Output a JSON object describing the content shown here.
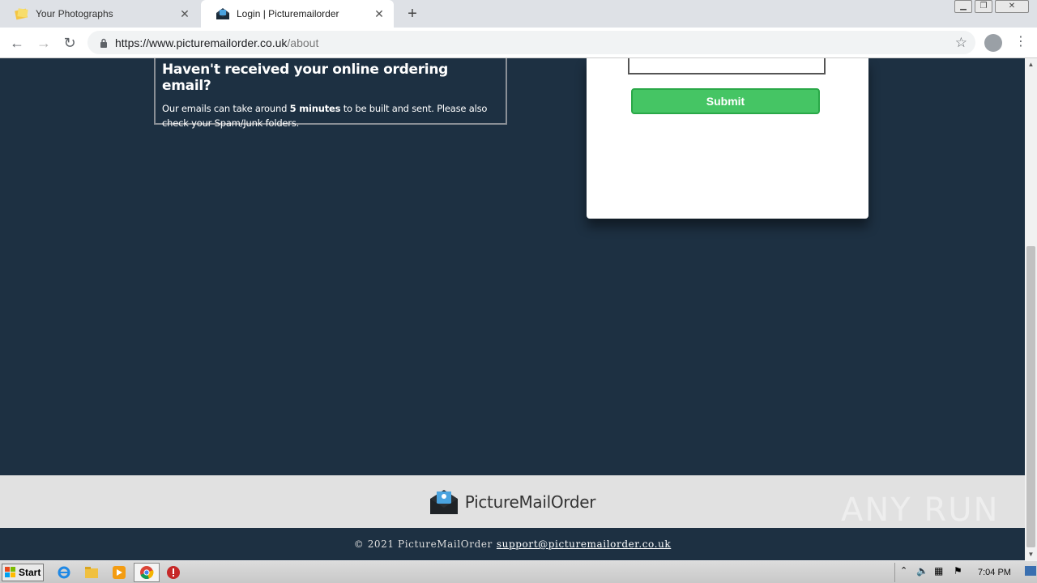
{
  "browser": {
    "tabs": [
      {
        "title": "Your Photographs",
        "active": false
      },
      {
        "title": "Login | Picturemailorder",
        "active": true
      }
    ],
    "url_host": "https://www.picturemailorder.co.uk",
    "url_path": "/about"
  },
  "page": {
    "info_heading": "Haven't received your online ordering email?",
    "info_text_1": "Our emails can take around ",
    "info_text_bold": "5 minutes",
    "info_text_2": " to be built and sent. Please also check your Spam/Junk folders.",
    "submit_label": "Submit",
    "brand_name": "PictureMailOrder",
    "copyright": "© 2021 PictureMailOrder",
    "support_email": "support@picturemailorder.co.uk",
    "watermark": "ANY RUN"
  },
  "taskbar": {
    "start_label": "Start",
    "clock": "7:04 PM"
  },
  "colors": {
    "page_bg": "#1d3042",
    "submit_green": "#45c564",
    "footer_bg": "#e1e1e1"
  }
}
